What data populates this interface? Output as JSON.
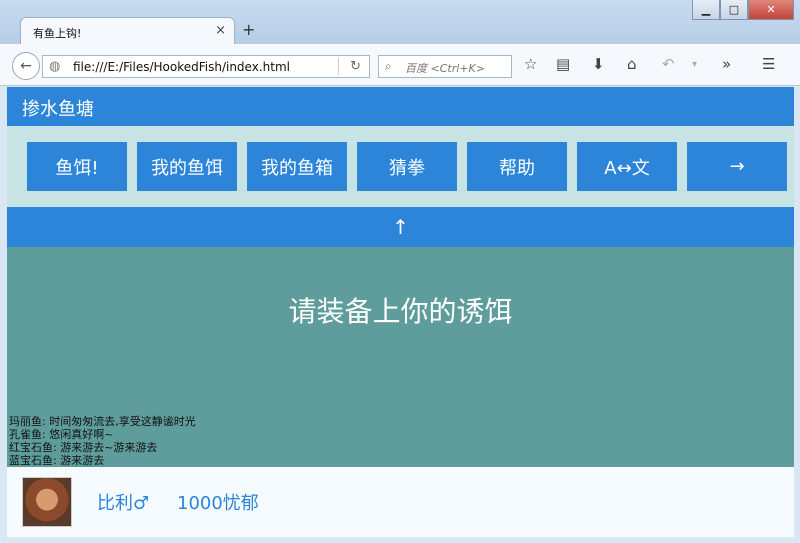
{
  "browser": {
    "tab_title": "有鱼上钩!",
    "tab_close": "×",
    "new_tab": "+",
    "url": "file:///E:/Files/HookedFish/index.html",
    "search_placeholder": "百度 <Ctrl+K>",
    "window_controls": [
      "▁",
      "□",
      "✕"
    ]
  },
  "site": {
    "title": "掺水鱼塘",
    "menu": [
      {
        "label": "鱼饵!"
      },
      {
        "label": "我的鱼饵"
      },
      {
        "label": "我的鱼箱"
      },
      {
        "label": "猜拳"
      },
      {
        "label": "帮助"
      },
      {
        "label": "A↔文"
      },
      {
        "label": "→"
      }
    ],
    "up_button": "↑",
    "main_message": "请装备上你的诱饵",
    "fish_log": [
      "玛丽鱼: 时间匆匆流去,享受这静谧时光",
      "孔雀鱼: 悠闲真好啊~",
      "红宝石鱼: 游来游去~游来游去",
      "蓝宝石鱼: 游来游去"
    ],
    "user": {
      "name": "比利♂",
      "gold": "1000忧郁"
    }
  }
}
